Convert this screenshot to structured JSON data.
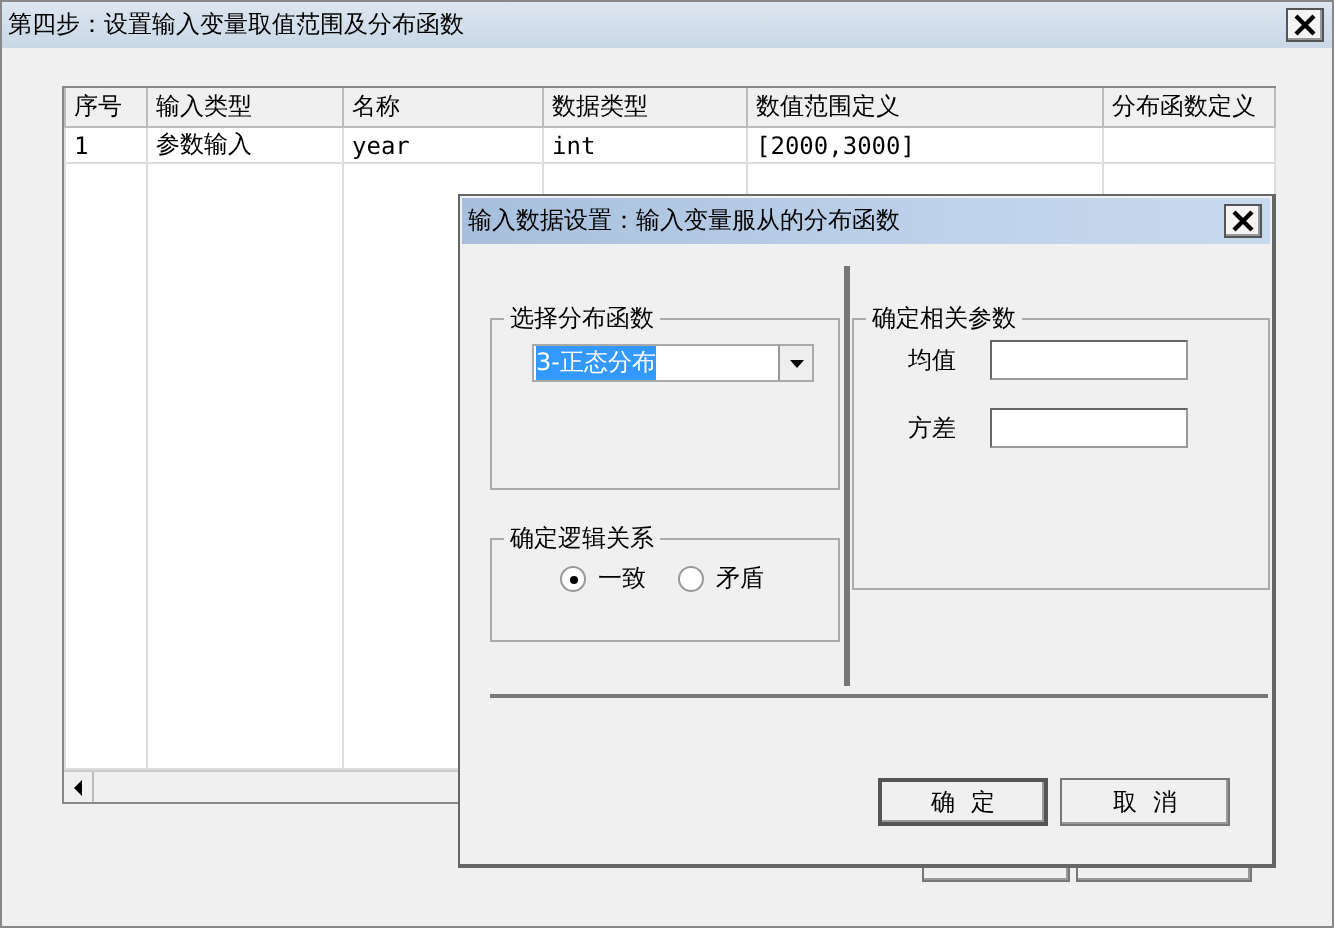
{
  "window": {
    "title": "第四步：设置输入变量取值范围及分布函数"
  },
  "table": {
    "columns": [
      "序号",
      "输入类型",
      "名称",
      "数据类型",
      "数值范围定义",
      "分布函数定义"
    ],
    "rows": [
      {
        "cells": [
          "1",
          "参数输入",
          "year",
          "int",
          "[2000,3000]",
          ""
        ]
      }
    ]
  },
  "dialog": {
    "title": "输入数据设置：输入变量服从的分布函数",
    "distribution_group": {
      "title": "选择分布函数",
      "select": {
        "value": "3-正态分布"
      }
    },
    "logic_group": {
      "title": "确定逻辑关系",
      "options": [
        {
          "label": "一致",
          "selected": true
        },
        {
          "label": "矛盾",
          "selected": false
        }
      ]
    },
    "params_group": {
      "title": "确定相关参数",
      "fields": [
        {
          "label": "均值"
        },
        {
          "label": "方差"
        }
      ]
    },
    "buttons": [
      "确  定",
      "取  消"
    ]
  }
}
